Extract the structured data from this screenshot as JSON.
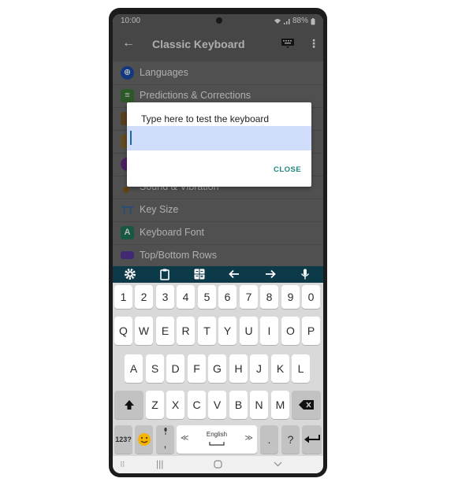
{
  "status_bar": {
    "time": "10:00",
    "battery": "88%"
  },
  "app_bar": {
    "title": "Classic Keyboard"
  },
  "settings_list": [
    {
      "label": "Languages",
      "icon": "globe-icon"
    },
    {
      "label": "Predictions & Corrections",
      "icon": "clipboard-icon"
    },
    {
      "label": "",
      "icon": "tools-icon"
    },
    {
      "label": "",
      "icon": "paint-icon"
    },
    {
      "label": "",
      "icon": "theme-icon"
    },
    {
      "label": "Sound & Vibration",
      "icon": "sound-icon"
    },
    {
      "label": "Key Size",
      "icon": "text-size-icon"
    },
    {
      "label": "Keyboard Font",
      "icon": "font-icon"
    },
    {
      "label": "Top/Bottom Rows",
      "icon": "rows-icon"
    }
  ],
  "dialog": {
    "title": "Type here to test the keyboard",
    "input_value": "",
    "close_label": "CLOSE"
  },
  "keyboard": {
    "toolbar": [
      "gear-icon",
      "clipboard-icon",
      "calculator-icon",
      "arrow-left-icon",
      "arrow-right-icon",
      "mic-icon"
    ],
    "number_row": [
      "1",
      "2",
      "3",
      "4",
      "5",
      "6",
      "7",
      "8",
      "9",
      "0"
    ],
    "row1": [
      "Q",
      "W",
      "E",
      "R",
      "T",
      "Y",
      "U",
      "I",
      "O",
      "P"
    ],
    "row2": [
      "A",
      "S",
      "D",
      "F",
      "G",
      "H",
      "J",
      "K",
      "L"
    ],
    "row3": [
      "Z",
      "X",
      "C",
      "V",
      "B",
      "N",
      "M"
    ],
    "bottom": {
      "mode": "123?",
      "comma": ",",
      "space_label": "English",
      "space_left": "≪",
      "space_right": "≫",
      "period": ".",
      "question": "?"
    }
  },
  "colors": {
    "toolbar": "#0c3a48",
    "accent": "#1f8a80",
    "input_highlight": "#cfdcfa"
  }
}
